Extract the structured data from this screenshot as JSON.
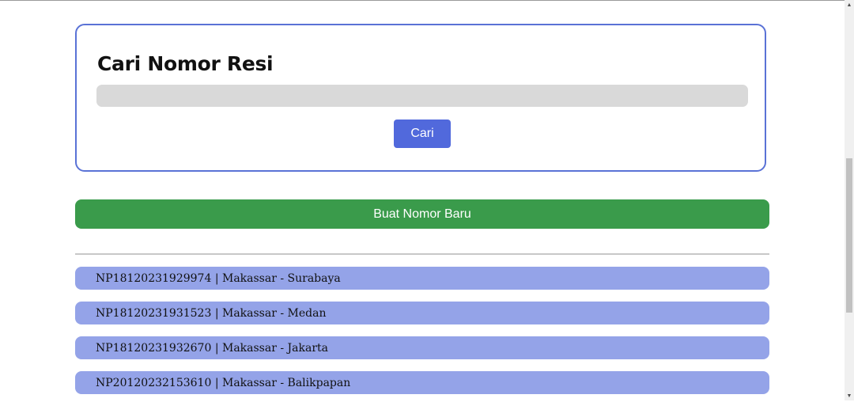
{
  "search": {
    "title": "Cari Nomor Resi",
    "input_value": "",
    "placeholder": "",
    "button_label": "Cari"
  },
  "actions": {
    "create_label": "Buat Nomor Baru"
  },
  "receipts": [
    {
      "label": "NP18120231929974 | Makassar - Surabaya"
    },
    {
      "label": "NP18120231931523 | Makassar - Medan"
    },
    {
      "label": "NP18120231932670 | Makassar - Jakarta"
    },
    {
      "label": "NP20120232153610 | Makassar - Balikpapan"
    }
  ],
  "colors": {
    "card_border": "#5a72d6",
    "search_button": "#5169dc",
    "create_button": "#3a9b4b",
    "receipt_item": "#94a3e8",
    "input_bg": "#d9d9d9"
  },
  "scrollbar": {
    "arrow_up_icon": "triangle-up-icon",
    "arrow_down_icon": "triangle-down-icon"
  }
}
